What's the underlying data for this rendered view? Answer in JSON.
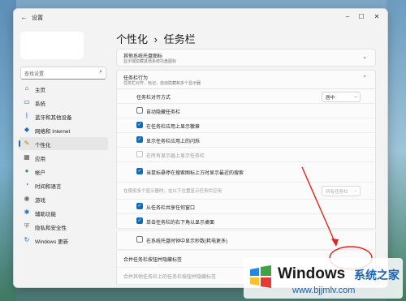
{
  "window": {
    "title": "设置",
    "back_icon": "back-arrow-icon"
  },
  "search": {
    "placeholder": "查找设置",
    "icon": "search-icon"
  },
  "sidebar": {
    "items": [
      {
        "label": "主页",
        "icon": "home-icon",
        "color": "#555555"
      },
      {
        "label": "系统",
        "icon": "monitor-icon",
        "color": "#1b6ec2"
      },
      {
        "label": "蓝牙和其他设备",
        "icon": "bluetooth-icon",
        "color": "#1b6ec2"
      },
      {
        "label": "网络和 Internet",
        "icon": "wifi-icon",
        "color": "#1b6ec2"
      },
      {
        "label": "个性化",
        "icon": "brush-icon",
        "color": "#c2741b",
        "active": true
      },
      {
        "label": "应用",
        "icon": "apps-icon",
        "color": "#555555"
      },
      {
        "label": "帐户",
        "icon": "account-icon",
        "color": "#2e9c4d"
      },
      {
        "label": "时间和语言",
        "icon": "globe-clock-icon",
        "color": "#1b6ec2"
      },
      {
        "label": "游戏",
        "icon": "gamepad-icon",
        "color": "#666666"
      },
      {
        "label": "辅助功能",
        "icon": "accessibility-icon",
        "color": "#1b6ec2"
      },
      {
        "label": "隐私和安全性",
        "icon": "shield-icon",
        "color": "#777777"
      },
      {
        "label": "Windows 更新",
        "icon": "update-icon",
        "color": "#1b6ec2"
      }
    ]
  },
  "breadcrumb": {
    "parent": "个性化",
    "separator": "›",
    "current": "任务栏"
  },
  "other_tray_card": {
    "title": "其他系统托盘图标",
    "subtitle": "显示或隐藏其他系统托盘图标"
  },
  "behaviors_card": {
    "title": "任务栏行为",
    "subtitle": "任务栏对齐、标记、自动隐藏和多个显示器"
  },
  "alignment": {
    "label": "任务栏对齐方式",
    "value": "居中"
  },
  "options": [
    {
      "label": "自动隐藏任务栏",
      "state": "off"
    },
    {
      "label": "在任务栏应用上显示徽章",
      "state": "on"
    },
    {
      "label": "显示任务栏应用上的闪烁",
      "state": "on"
    },
    {
      "label": "在所有显示器上显示任务栏",
      "state": "disabled"
    },
    {
      "label": "当鼠标悬停在搜索图标上方时显示最近的搜索",
      "state": "on"
    }
  ],
  "multi_display": {
    "label": "在使用多个显示器时，在以下位置显示任务栏应用",
    "value": "所有任务栏"
  },
  "options2": [
    {
      "label": "从任务栏共享任何窗口",
      "state": "on"
    },
    {
      "label": "单击任务栏的右下角以显示桌面",
      "state": "on"
    },
    {
      "label": "在系统托盘时钟中显示秒数(耗电更多)",
      "state": "off"
    }
  ],
  "combine": {
    "label": "合并任务栏按钮并隐藏标签"
  },
  "combine_other": {
    "label": "合并其他任务栏上的任务栏按钮并隐藏标签"
  },
  "watermark": {
    "brand": "Windows",
    "cn": "系统之家",
    "url": "www.bjjmlv.com"
  },
  "colors": {
    "accent": "#0f6cbd",
    "annotation": "#e0261f"
  }
}
